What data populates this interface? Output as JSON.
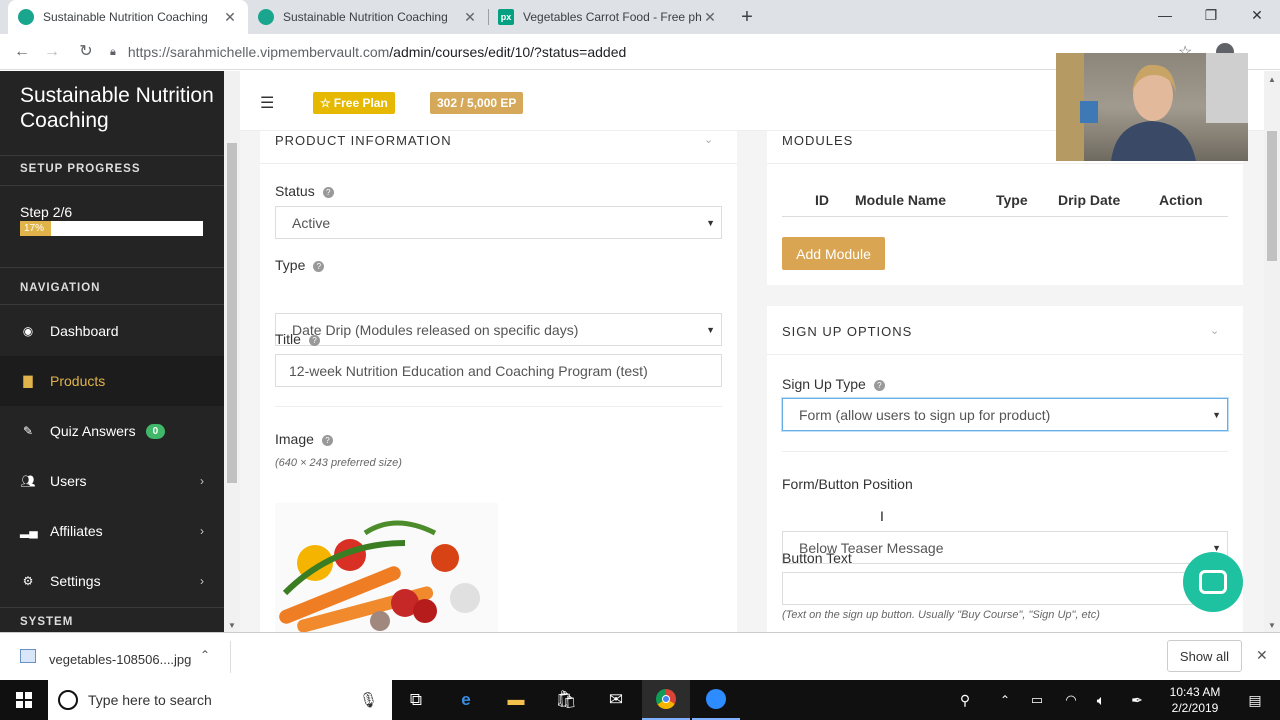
{
  "browser": {
    "tabs": [
      {
        "title": "Sustainable Nutrition Coaching",
        "active": true
      },
      {
        "title": "Sustainable Nutrition Coaching",
        "active": false
      },
      {
        "title": "Vegetables Carrot Food - Free ph",
        "active": false
      }
    ],
    "url_domain": "https://sarahmichelle.vipmembervault.com",
    "url_path": "/admin/courses/edit/10/?status=added"
  },
  "sidebar": {
    "brand": "Sustainable Nutrition Coaching",
    "setup_heading": "SETUP PROGRESS",
    "step_label": "Step 2/6",
    "progress_label": "17%",
    "progress_value": 17,
    "nav_heading": "NAVIGATION",
    "items": [
      {
        "label": "Dashboard",
        "icon": "dashboard-icon"
      },
      {
        "label": "Products",
        "icon": "products-icon"
      },
      {
        "label": "Quiz Answers",
        "icon": "pencil-icon",
        "badge": "0"
      },
      {
        "label": "Users",
        "icon": "users-icon"
      },
      {
        "label": "Affiliates",
        "icon": "chart-icon"
      },
      {
        "label": "Settings",
        "icon": "gear-icon"
      }
    ],
    "system_heading": "SYSTEM"
  },
  "topbar": {
    "plan_label": "Free Plan",
    "ep_label": "302 / 5,000 EP",
    "plan_color": "#e6b800",
    "ep_color": "#d6a95a"
  },
  "product_info": {
    "heading": "PRODUCT INFORMATION",
    "status_label": "Status",
    "status_value": "Active",
    "type_label": "Type",
    "type_value": "Date Drip (Modules released on specific days)",
    "title_label": "Title",
    "title_value": "12-week Nutrition Education and Coaching Program (test)",
    "image_label": "Image",
    "image_hint": "(640 × 243 preferred size)"
  },
  "modules": {
    "heading": "MODULES",
    "columns": [
      "ID",
      "Module Name",
      "Type",
      "Drip Date",
      "Action"
    ],
    "add_label": "Add Module"
  },
  "signup": {
    "heading": "SIGN UP OPTIONS",
    "type_label": "Sign Up Type",
    "type_value": "Form (allow users to sign up for product)",
    "position_label": "Form/Button Position",
    "position_value": "Below Teaser Message",
    "button_text_label": "Button Text",
    "button_text_value": "",
    "button_text_hint": "(Text on the sign up button. Usually \"Buy Course\", \"Sign Up\", etc)"
  },
  "downloads": {
    "file": "vegetables-108506....jpg",
    "show_all": "Show all"
  },
  "taskbar": {
    "search_placeholder": "Type here to search",
    "time": "10:43 AM",
    "date": "2/2/2019"
  },
  "colors": {
    "accent": "#e0b44b",
    "button": "#d9a553",
    "chat": "#1ec1a0"
  }
}
